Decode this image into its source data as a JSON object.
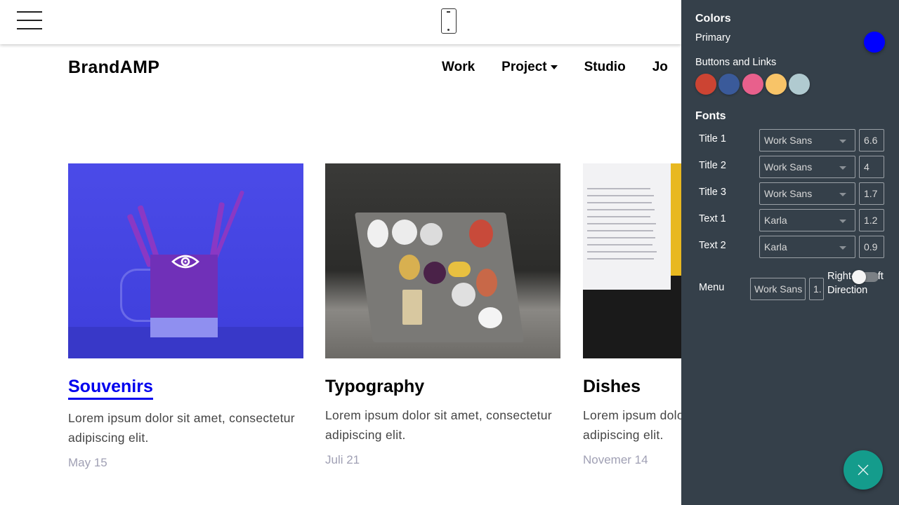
{
  "header": {
    "brand": "BrandAMP",
    "nav": [
      {
        "label": "Work"
      },
      {
        "label": "Project",
        "has_dropdown": true
      },
      {
        "label": "Studio"
      },
      {
        "label": "Jo"
      }
    ],
    "icons": {
      "menu": "hamburger-icon",
      "device": "mobile-phone-icon"
    }
  },
  "cards": [
    {
      "title": "Souvenirs",
      "text": "Lorem ipsum dolor sit amet, consectetur adipiscing elit.",
      "date": "May 15",
      "active": true,
      "overlay_icon": "eye-icon"
    },
    {
      "title": "Typography",
      "text": "Lorem ipsum dolor sit amet, consectetur adipiscing elit.",
      "date": "Juli 21"
    },
    {
      "title": "Dishes",
      "text": "Lorem ipsum dolor sit amet, consectetur adipiscing elit.",
      "date": "Novemer 14"
    }
  ],
  "panel": {
    "colors_heading": "Colors",
    "primary_label": "Primary",
    "primary_color": "#0000ff",
    "buttons_links_label": "Buttons and Links",
    "swatches": [
      "#cc4433",
      "#3a5a9a",
      "#e8608c",
      "#f8c468",
      "#b0cad0"
    ],
    "fonts_heading": "Fonts",
    "fonts": [
      {
        "label": "Title 1",
        "font": "Work Sans",
        "size": "6.6"
      },
      {
        "label": "Title 2",
        "font": "Work Sans",
        "size": "4"
      },
      {
        "label": "Title 3",
        "font": "Work Sans",
        "size": "1.7"
      },
      {
        "label": "Text 1",
        "font": "Karla",
        "size": "1.2"
      },
      {
        "label": "Text 2",
        "font": "Karla",
        "size": "0.9"
      }
    ],
    "menu": {
      "label": "Menu",
      "font": "Work Sans",
      "size": "1."
    },
    "rtl": {
      "label": "Right-to-Left Direction",
      "enabled": false
    },
    "close_icon": "close-icon",
    "accent": "#149c8c"
  }
}
